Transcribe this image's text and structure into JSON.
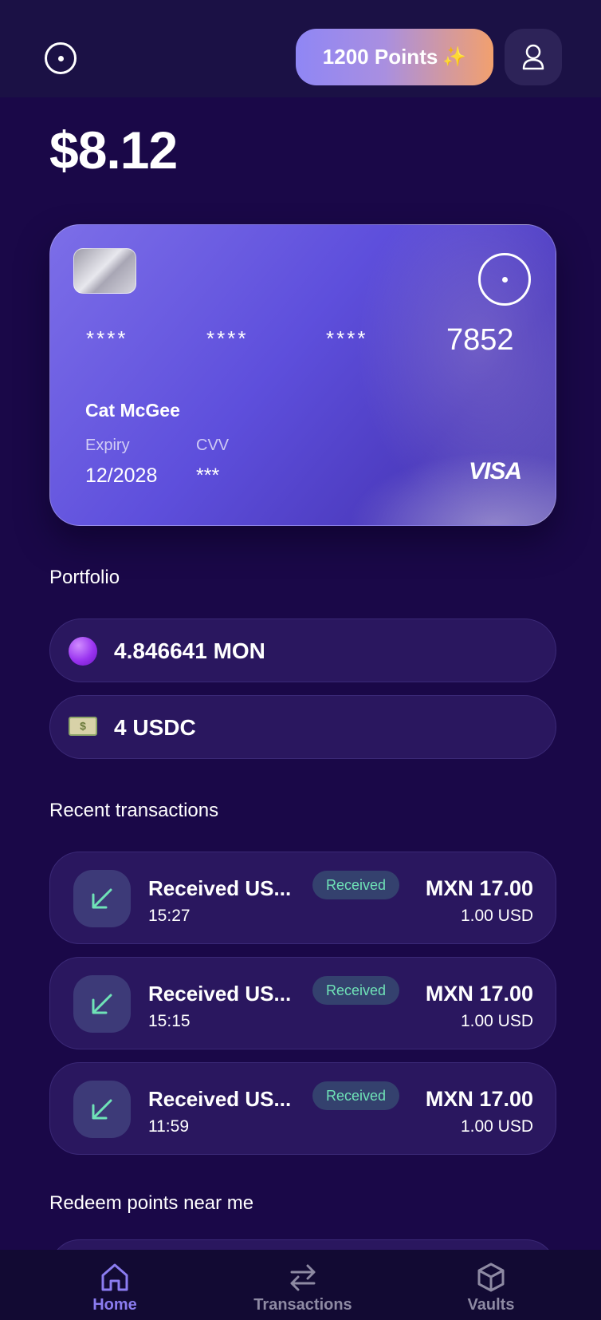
{
  "header": {
    "points_label": "1200 Points",
    "sparkle": "✨"
  },
  "balance": "$8.12",
  "card": {
    "number_groups": [
      "****",
      "****",
      "****"
    ],
    "last4": "7852",
    "holder": "Cat McGee",
    "expiry_label": "Expiry",
    "expiry_value": "12/2028",
    "cvv_label": "CVV",
    "cvv_value": "***",
    "network": "VISA"
  },
  "portfolio": {
    "title": "Portfolio",
    "items": [
      {
        "icon": "purple-coin-icon",
        "label": "4.846641 MON"
      },
      {
        "icon": "cash-icon",
        "label": "4 USDC"
      }
    ]
  },
  "recent": {
    "title": "Recent transactions",
    "items": [
      {
        "title": "Received US...",
        "time": "15:27",
        "badge": "Received",
        "amount": "MXN 17.00",
        "sub": "1.00 USD"
      },
      {
        "title": "Received US...",
        "time": "15:15",
        "badge": "Received",
        "amount": "MXN 17.00",
        "sub": "1.00 USD"
      },
      {
        "title": "Received US...",
        "time": "11:59",
        "badge": "Received",
        "amount": "MXN 17.00",
        "sub": "1.00 USD"
      }
    ]
  },
  "redeem": {
    "title": "Redeem points near me"
  },
  "nav": {
    "items": [
      {
        "label": "Home",
        "icon": "home-icon",
        "active": true
      },
      {
        "label": "Transactions",
        "icon": "swap-arrows-icon",
        "active": false
      },
      {
        "label": "Vaults",
        "icon": "cube-icon",
        "active": false
      }
    ]
  },
  "colors": {
    "background": "#1a0848",
    "accent": "#8b7cf0",
    "received_badge_text": "#6fe3b7"
  }
}
